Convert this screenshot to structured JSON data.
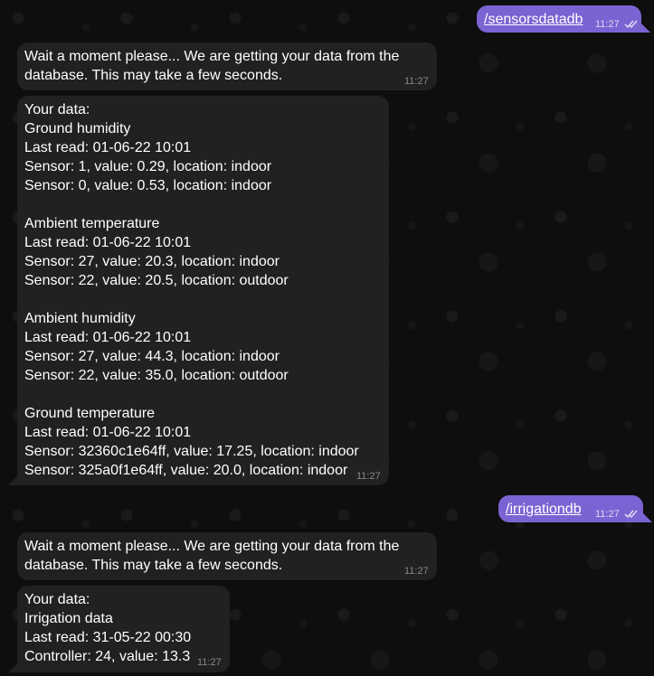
{
  "messages": [
    {
      "from": "me",
      "text": "/sensorsdatadb",
      "time": "11:27",
      "read": true
    },
    {
      "from": "bot",
      "text": "Wait a moment please... We are getting your data from the\ndatabase. This may take a few seconds.",
      "time": "11:27"
    },
    {
      "from": "bot",
      "text": "Your data:\nGround humidity\nLast read: 01-06-22 10:01\nSensor: 1, value: 0.29, location: indoor\nSensor: 0, value: 0.53, location: indoor\n\nAmbient temperature\nLast read: 01-06-22 10:01\nSensor: 27, value: 20.3, location: indoor\nSensor: 22, value: 20.5, location: outdoor\n\nAmbient humidity\nLast read: 01-06-22 10:01\nSensor: 27, value: 44.3, location: indoor\nSensor: 22, value: 35.0, location: outdoor\n\nGround temperature\nLast read: 01-06-22 10:01\nSensor: 32360c1e64ff, value: 17.25, location: indoor\nSensor: 325a0f1e64ff, value: 20.0, location: indoor",
      "time": "11:27"
    },
    {
      "from": "me",
      "text": "/irrigationdb",
      "time": "11:27",
      "read": true
    },
    {
      "from": "bot",
      "text": "Wait a moment please... We are getting your data from the\ndatabase. This may take a few seconds.",
      "time": "11:27"
    },
    {
      "from": "bot",
      "text": "Your data:\nIrrigation data\nLast read: 31-05-22 00:30\nController: 24, value: 13.3",
      "time": "11:27"
    }
  ],
  "colors": {
    "outgoing_bubble": "#7b63d3",
    "incoming_bubble": "#212121",
    "background": "#0e0e0e"
  },
  "icons": {
    "read_status": "double-check-icon"
  }
}
